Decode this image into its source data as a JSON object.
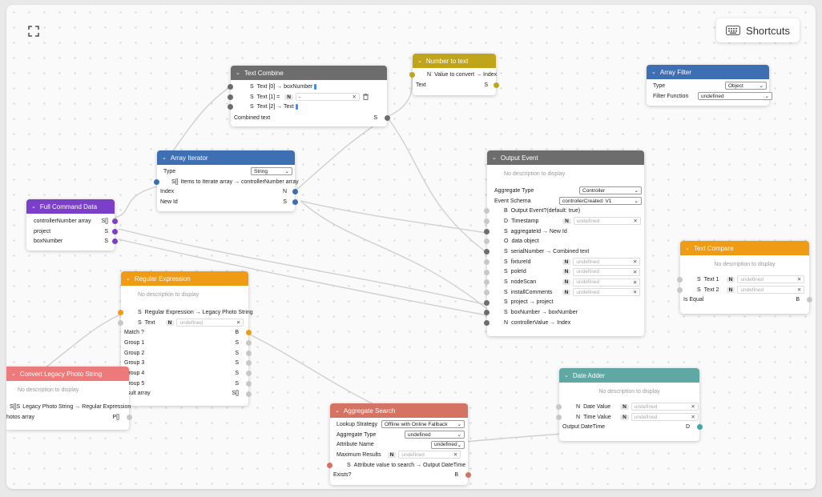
{
  "canvas": {
    "shortcuts_label": "Shortcuts",
    "icons": {
      "fullscreen": "fullscreen-icon",
      "keyboard": "keyboard-icon",
      "chevron": "chevron-down-icon",
      "close": "close-icon",
      "trash": "trash-icon"
    }
  },
  "colors": {
    "gray": "#6d6d6d",
    "orange": "#ef9b16",
    "purple": "#7b3fc9",
    "blue": "#3e6fb3",
    "salmon": "#d47363",
    "pink": "#ec7a7a",
    "olive": "#c0a41a",
    "teal": "#5fa8a3"
  },
  "text_combine": {
    "title": "Text Combine",
    "rows": [
      {
        "type": "S",
        "label": "Text [0] → boxNumber"
      },
      {
        "type": "S",
        "label": "Text [1] ="
      },
      {
        "type": "S",
        "label": "Text [2] → Text"
      }
    ],
    "text1_value": "-",
    "output_label": "Combined text",
    "output_type": "S"
  },
  "number_to_text": {
    "title": "Number to text",
    "input": {
      "type": "N",
      "label": "Value to convert → Index"
    },
    "output_label": "Text",
    "output_type": "S"
  },
  "array_filter": {
    "title": "Array Filter",
    "type_label": "Type",
    "type_value": "Object",
    "func_label": "Filter Function",
    "func_value": "undefined"
  },
  "array_iterator": {
    "title": "Array Iterator",
    "type_label": "Type",
    "type_value": "String",
    "input": {
      "type": "S[]",
      "label": "Items to Iterate array → controllerNumber array"
    },
    "outputs": [
      {
        "label": "Index",
        "type": "N"
      },
      {
        "label": "New Id",
        "type": "S"
      }
    ]
  },
  "full_command_data": {
    "title": "Full Command Data",
    "outputs": [
      {
        "label": "controllerNumber array",
        "type": "S[]"
      },
      {
        "label": "project",
        "type": "S"
      },
      {
        "label": "boxNumber",
        "type": "S"
      }
    ]
  },
  "output_event": {
    "title": "Output Event",
    "description": "No description to display",
    "aggregate_label": "Aggregate Type",
    "aggregate_value": "Controller",
    "schema_label": "Event Schema",
    "schema_value": "controllerCreated: V1",
    "rows": [
      {
        "type": "B",
        "label": "Output Event?(default: true)"
      },
      {
        "type": "D",
        "label": "Timestamp",
        "field": "undefined"
      },
      {
        "type": "S",
        "label": "aggregateId → New Id"
      },
      {
        "type": "O",
        "label": "data object"
      },
      {
        "type": "S",
        "label": "serialNumber → Combined text"
      },
      {
        "type": "S",
        "label": "fixtureId",
        "field": "undefined"
      },
      {
        "type": "S",
        "label": "poleId",
        "field": "undefined"
      },
      {
        "type": "S",
        "label": "nodeScan",
        "field": "undefined"
      },
      {
        "type": "S",
        "label": "installComments",
        "field": "undefined"
      },
      {
        "type": "S",
        "label": "project → project"
      },
      {
        "type": "S",
        "label": "boxNumber → boxNumber"
      },
      {
        "type": "N",
        "label": "controllerValue → Index"
      }
    ]
  },
  "text_compare": {
    "title": "Text Compare",
    "description": "No description to display",
    "rows": [
      {
        "type": "S",
        "label": "Text 1",
        "field": "undefined"
      },
      {
        "type": "S",
        "label": "Text 2",
        "field": "undefined"
      }
    ],
    "output_label": "Is Equal",
    "output_type": "B"
  },
  "regular_expression": {
    "title": "Regular Expression",
    "description": "No description to display",
    "inputs": [
      {
        "type": "S",
        "label": "Regular Expression → Legacy Photo String"
      },
      {
        "type": "S",
        "label": "Text",
        "field": "undefined"
      }
    ],
    "outputs": [
      {
        "label": "Match ?",
        "type": "B"
      },
      {
        "label": "Group 1",
        "type": "S"
      },
      {
        "label": "Group 2",
        "type": "S"
      },
      {
        "label": "Group 3",
        "type": "S"
      },
      {
        "label": "Group 4",
        "type": "S"
      },
      {
        "label": "Group 5",
        "type": "S"
      },
      {
        "label": "esult array",
        "type": "S[]"
      }
    ]
  },
  "convert_legacy": {
    "title": "Convert Legacy Photo String",
    "description": "No description to display",
    "input": {
      "type": "S[]S",
      "label": "Legacy Photo String → Regular Expression"
    },
    "output_label": "hotos array",
    "output_type": "P[]"
  },
  "aggregate_search": {
    "title": "Aggregate Search",
    "lookup_label": "Lookup Strategy",
    "lookup_value": "Offline with Online Fallback",
    "agg_label": "Aggregate Type",
    "agg_value": "undefined",
    "attr_label": "Attribute Name",
    "attr_value": "undefined",
    "max_label": "Maximum Results",
    "max_field": "undefined",
    "input": {
      "type": "S",
      "label": "Attribute value to search → Output DateTime"
    },
    "output_label": "Exists?",
    "output_type": "B"
  },
  "date_adder": {
    "title": "Date Adder",
    "description": "No description to display",
    "rows": [
      {
        "type": "N",
        "label": "Date Value",
        "field": "undefined"
      },
      {
        "type": "N",
        "label": "Time Value",
        "field": "undefined"
      }
    ],
    "output_label": "Output DateTime",
    "output_type": "D"
  }
}
